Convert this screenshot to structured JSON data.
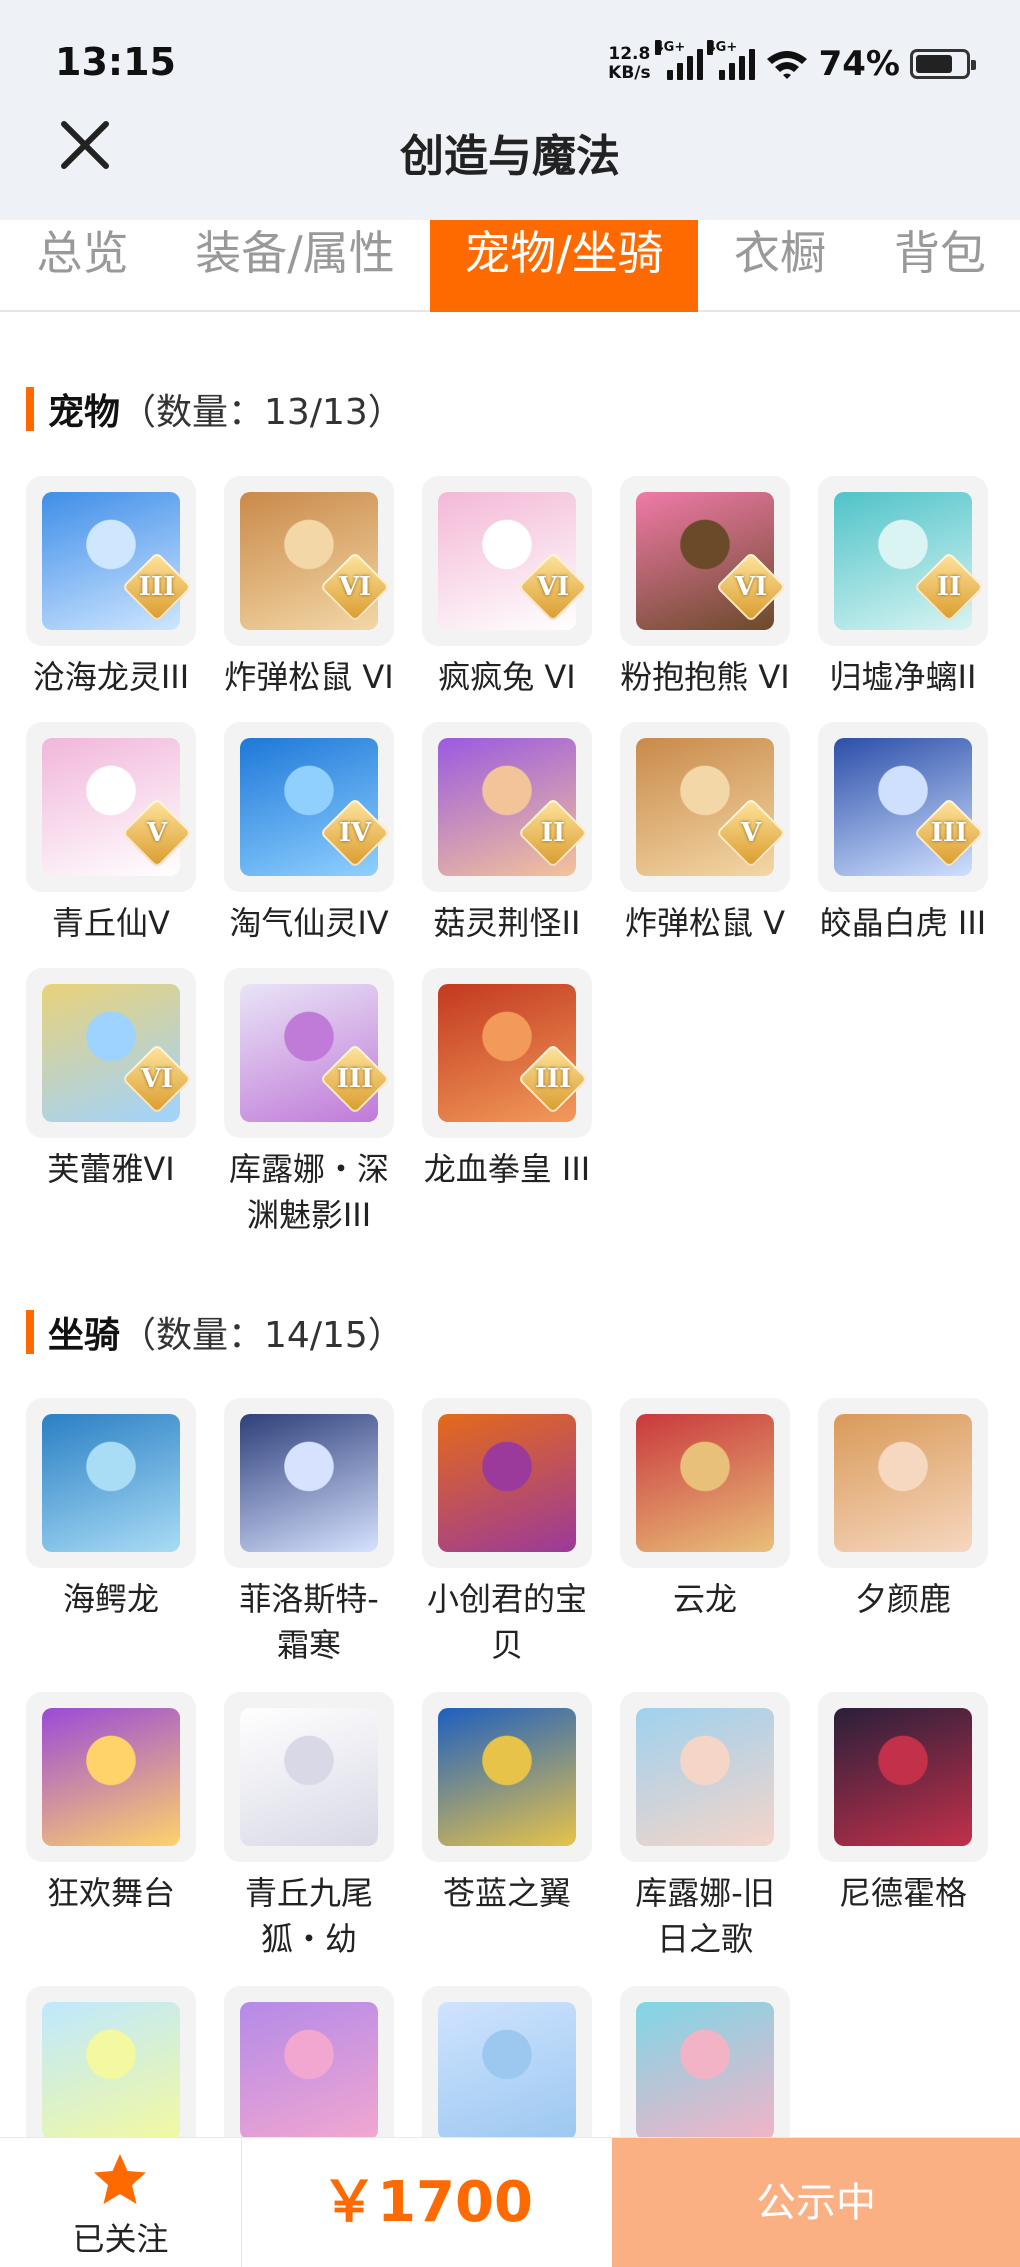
{
  "status": {
    "time": "13:15",
    "net_speed_value": "12.8",
    "net_speed_unit": "KB/s",
    "network_tag_1": "4G+",
    "network_tag_2": "4G+",
    "battery_percent": "74%",
    "battery_level": 0.74
  },
  "header": {
    "title": "创造与魔法",
    "close_icon": "close-icon"
  },
  "tabs": [
    {
      "label": "总览",
      "active": false
    },
    {
      "label": "装备/属性",
      "active": false
    },
    {
      "label": "宠物/坐骑",
      "active": true
    },
    {
      "label": "衣橱",
      "active": false
    },
    {
      "label": "背包",
      "active": false
    }
  ],
  "pets": {
    "title": "宠物",
    "count_text": "（数量：13/13）",
    "items": [
      {
        "name": "沧海龙灵III",
        "badge": "III",
        "colors": [
          "#3f8ee8",
          "#cfe6ff"
        ]
      },
      {
        "name": "炸弹松鼠 VI",
        "badge": "VI",
        "colors": [
          "#c98a4a",
          "#f3d7a6"
        ]
      },
      {
        "name": "疯疯兔 VI",
        "badge": "VI",
        "colors": [
          "#f3b8d6",
          "#ffffff"
        ]
      },
      {
        "name": "粉抱抱熊 VI",
        "badge": "VI",
        "colors": [
          "#f07aa8",
          "#6b4a2a"
        ]
      },
      {
        "name": "归墟净螭II",
        "badge": "II",
        "colors": [
          "#4fc3c9",
          "#d9f4f2"
        ]
      },
      {
        "name": "青丘仙V",
        "badge": "V",
        "colors": [
          "#f1b6da",
          "#ffffff"
        ]
      },
      {
        "name": "淘气仙灵IV",
        "badge": "IV",
        "colors": [
          "#1e78d8",
          "#8fd0ff"
        ]
      },
      {
        "name": "菇灵荆怪II",
        "badge": "II",
        "colors": [
          "#9a5ae0",
          "#f3c39a"
        ]
      },
      {
        "name": "炸弹松鼠 V",
        "badge": "V",
        "colors": [
          "#c98a4a",
          "#f3d7a6"
        ]
      },
      {
        "name": "皎晶白虎 III",
        "badge": "III",
        "colors": [
          "#2b4fa8",
          "#cfe0ff"
        ]
      },
      {
        "name": "芙蕾雅VI",
        "badge": "VI",
        "colors": [
          "#e9d27a",
          "#9fd3ff"
        ]
      },
      {
        "name": "库露娜・深渊魅影III",
        "badge": "III",
        "colors": [
          "#e9e4f7",
          "#c07ad8"
        ]
      },
      {
        "name": "龙血拳皇 III",
        "badge": "III",
        "colors": [
          "#c2391f",
          "#f29a5a"
        ]
      }
    ]
  },
  "mounts": {
    "title": "坐骑",
    "count_text": "（数量：14/15）",
    "items": [
      {
        "name": "海鳄龙",
        "colors": [
          "#2a7fc4",
          "#a9dcf5"
        ]
      },
      {
        "name": "菲洛斯特-霜寒",
        "colors": [
          "#2e3f7a",
          "#d6e2ff"
        ]
      },
      {
        "name": "小创君的宝贝",
        "colors": [
          "#e46a1a",
          "#9b3a9a"
        ]
      },
      {
        "name": "云龙",
        "colors": [
          "#c9383d",
          "#e9c07a"
        ]
      },
      {
        "name": "夕颜鹿",
        "colors": [
          "#d99a58",
          "#f6d7c0"
        ]
      },
      {
        "name": "狂欢舞台",
        "colors": [
          "#9a4ad8",
          "#ffd26a"
        ]
      },
      {
        "name": "青丘九尾狐・幼",
        "colors": [
          "#ffffff",
          "#d8d8e6"
        ]
      },
      {
        "name": "苍蓝之翼",
        "colors": [
          "#1d5fbf",
          "#e7c34a"
        ]
      },
      {
        "name": "库露娜-旧日之歌",
        "colors": [
          "#9fd1ef",
          "#f5d5c8"
        ]
      },
      {
        "name": "尼德霍格",
        "colors": [
          "#2a1f3a",
          "#c2304a"
        ]
      },
      {
        "name": "",
        "colors": [
          "#bfe8ff",
          "#f3f9a0"
        ]
      },
      {
        "name": "",
        "colors": [
          "#b48ae8",
          "#f2a7d0"
        ]
      },
      {
        "name": "",
        "colors": [
          "#cfe3ff",
          "#9cc8f0"
        ]
      },
      {
        "name": "",
        "colors": [
          "#7fd6e6",
          "#f3b3c6"
        ]
      }
    ]
  },
  "bottom": {
    "follow_label": "已关注",
    "price": "￥1700",
    "status_button": "公示中"
  },
  "colors": {
    "accent": "#ff6a00",
    "status_button_bg": "#fbb084"
  }
}
